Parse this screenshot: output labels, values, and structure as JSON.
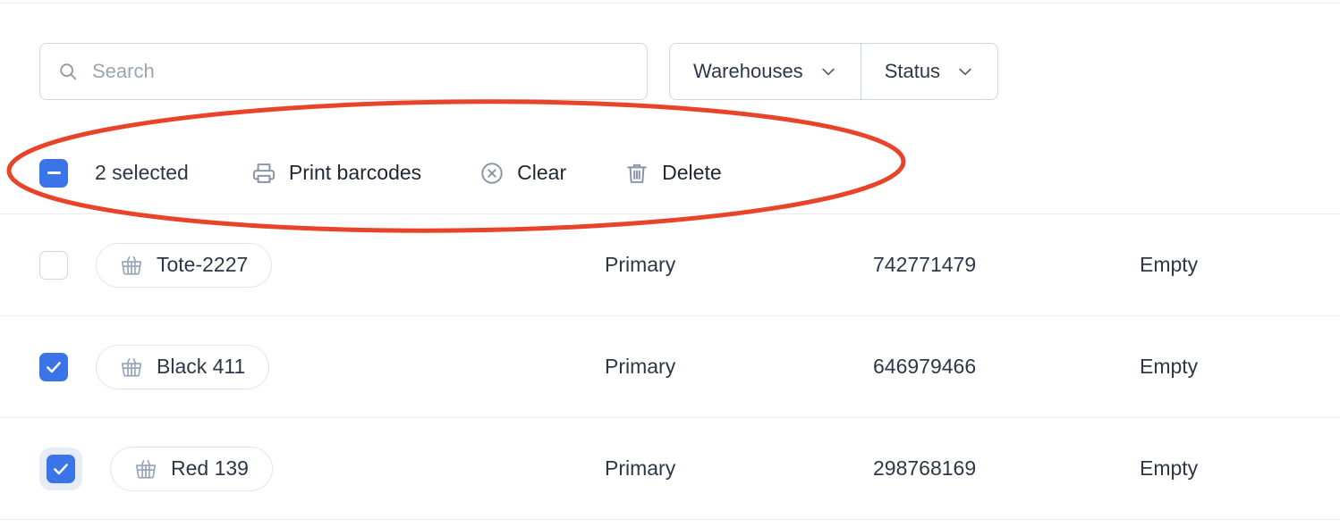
{
  "search": {
    "placeholder": "Search",
    "value": "",
    "icon": "search-icon"
  },
  "filters": [
    {
      "label": "Warehouses",
      "icon": "chevron-down-icon"
    },
    {
      "label": "Status",
      "icon": "chevron-down-icon"
    }
  ],
  "selection_toolbar": {
    "checkbox_state": "indeterminate",
    "count_label": "2 selected",
    "actions": [
      {
        "label": "Print barcodes",
        "icon": "printer-icon"
      },
      {
        "label": "Clear",
        "icon": "close-circle-icon"
      },
      {
        "label": "Delete",
        "icon": "trash-icon"
      }
    ]
  },
  "table": {
    "rows": [
      {
        "selected": false,
        "focused": false,
        "name": "Tote-2227",
        "icon": "basket-icon",
        "warehouse": "Primary",
        "code": "742771479",
        "status": "Empty"
      },
      {
        "selected": true,
        "focused": false,
        "name": "Black 411",
        "icon": "basket-icon",
        "warehouse": "Primary",
        "code": "646979466",
        "status": "Empty"
      },
      {
        "selected": true,
        "focused": true,
        "name": "Red 139",
        "icon": "basket-icon",
        "warehouse": "Primary",
        "code": "298768169",
        "status": "Empty"
      }
    ]
  },
  "annotation": {
    "shape": "ellipse",
    "color": "#e8442a",
    "stroke_width": 5
  },
  "colors": {
    "accent": "#3b73e8",
    "text": "#2d3748",
    "border": "#ccd6e5",
    "divider": "#e9edf3",
    "annotation": "#e8442a"
  }
}
